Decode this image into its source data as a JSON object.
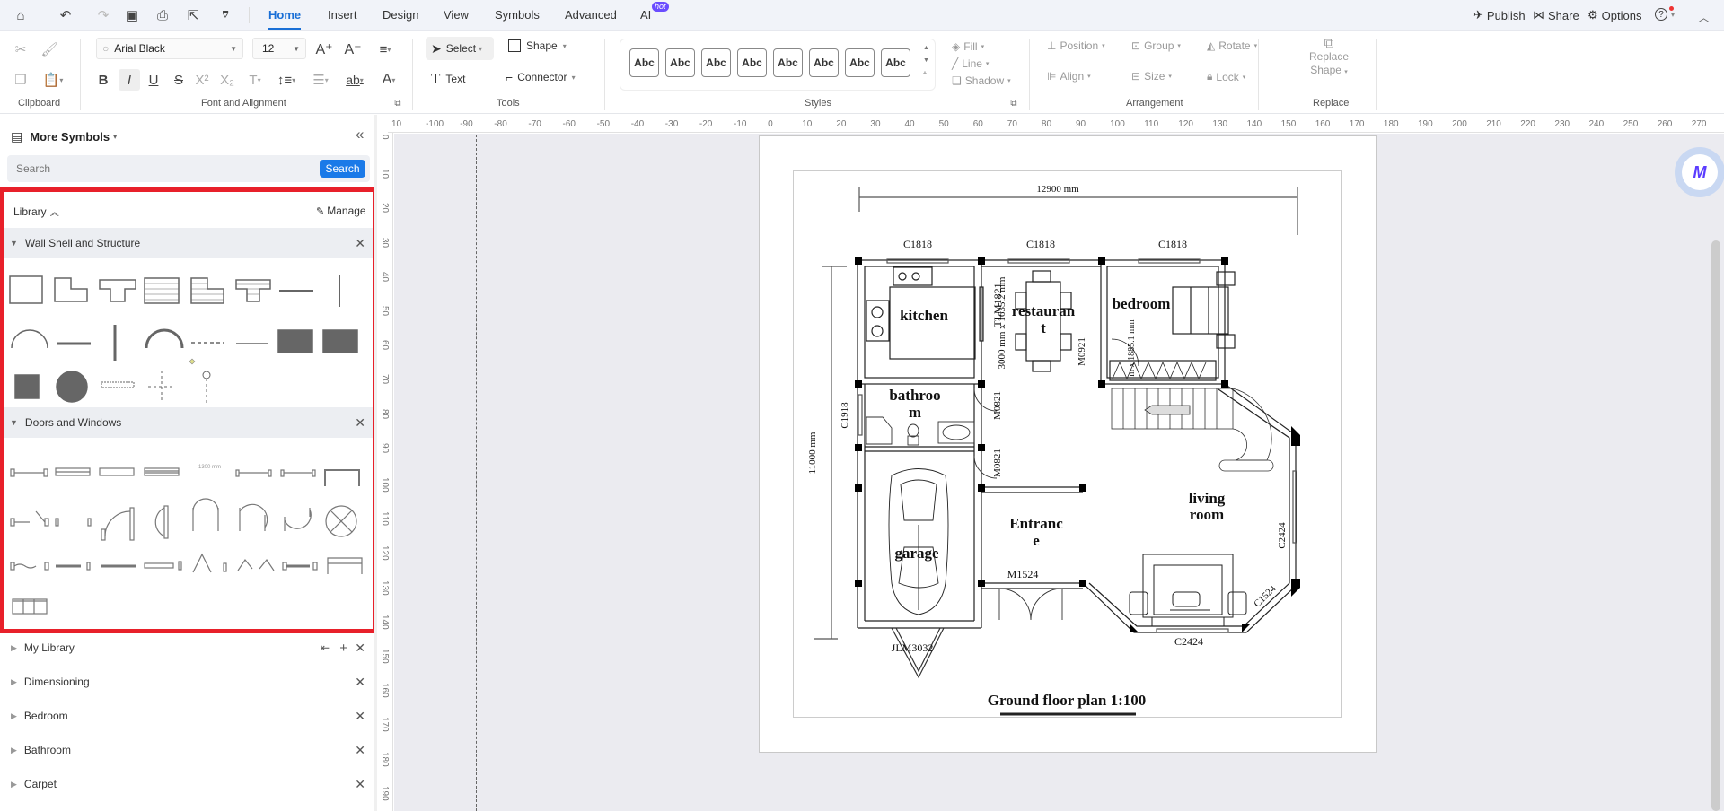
{
  "menubar": {
    "tabs": [
      "Home",
      "Insert",
      "Design",
      "View",
      "Symbols",
      "Advanced",
      "AI"
    ],
    "active_tab": "Home",
    "hot_badge": "hot",
    "publish": "Publish",
    "share": "Share",
    "options": "Options"
  },
  "ribbon": {
    "font_name": "Arial Black",
    "font_size": "12",
    "select_label": "Select",
    "shape_label": "Shape",
    "text_label": "Text",
    "connector_label": "Connector",
    "style_swatch": "Abc",
    "fill_label": "Fill",
    "line_label": "Line",
    "shadow_label": "Shadow",
    "position_label": "Position",
    "group_label": "Group",
    "rotate_label": "Rotate",
    "align_label": "Align",
    "size_label": "Size",
    "lock_label": "Lock",
    "replace_shape_line1": "Replace",
    "replace_shape_line2": "Shape",
    "groups": {
      "clipboard": "Clipboard",
      "font": "Font and Alignment",
      "tools": "Tools",
      "styles": "Styles",
      "arrangement": "Arrangement",
      "replace": "Replace"
    }
  },
  "sidebar": {
    "title": "More Symbols",
    "search_placeholder": "Search",
    "search_button": "Search",
    "library_label": "Library",
    "manage_label": "Manage",
    "sections": [
      {
        "name": "Wall Shell and Structure",
        "expanded": true,
        "symbol_count": 21
      },
      {
        "name": "Doors and Windows",
        "expanded": true,
        "symbol_count": 25
      }
    ],
    "collapsed_libraries": [
      "My Library",
      "Dimensioning",
      "Bedroom",
      "Bathroom",
      "Carpet"
    ]
  },
  "rulers": {
    "horizontal": [
      "10",
      "-100",
      "-90",
      "-80",
      "-70",
      "-60",
      "-50",
      "-40",
      "-30",
      "-20",
      "-10",
      "0",
      "10",
      "20",
      "30",
      "40",
      "50",
      "60",
      "70",
      "80",
      "90",
      "100",
      "110",
      "120",
      "130",
      "140",
      "150",
      "160",
      "170",
      "180",
      "190",
      "200",
      "210",
      "220",
      "230",
      "240",
      "250",
      "260",
      "270"
    ],
    "vertical": [
      "0",
      "10",
      "20",
      "30",
      "40",
      "50",
      "60",
      "70",
      "80",
      "90",
      "100",
      "110",
      "120",
      "130",
      "140",
      "150",
      "160",
      "170",
      "180",
      "190"
    ]
  },
  "floorplan": {
    "title": "Ground floor plan 1:100",
    "width_dim": "12900 mm",
    "height_dim": "11000 mm",
    "rooms": {
      "kitchen": "kitchen",
      "restaurant_1": "restauran",
      "restaurant_2": "t",
      "bedroom": "bedroom",
      "bathroom_1": "bathroo",
      "bathroom_2": "m",
      "garage": "garage",
      "entrance_1": "Entranc",
      "entrance_2": "e",
      "living_1": "living",
      "living_2": "room"
    },
    "labels": {
      "window_c1818_a": "C1818",
      "window_c1818_b": "C1818",
      "window_c1818_c": "C1818",
      "window_c1918": "C1918",
      "door_m0921": "M0921",
      "door_m0821_a": "M0821",
      "door_m0821_b": "M0821",
      "door_tlm": "TLM1821",
      "door_tlm_dim": "3000 mm x 1635.2 mm",
      "bed_dim": "m x 1885.1 mm",
      "door_m1524": "M1524",
      "window_c2424_a": "C2424",
      "window_c2424_b": "C2424",
      "window_c1524": "C1524",
      "garage_door": "JLM3032"
    }
  }
}
